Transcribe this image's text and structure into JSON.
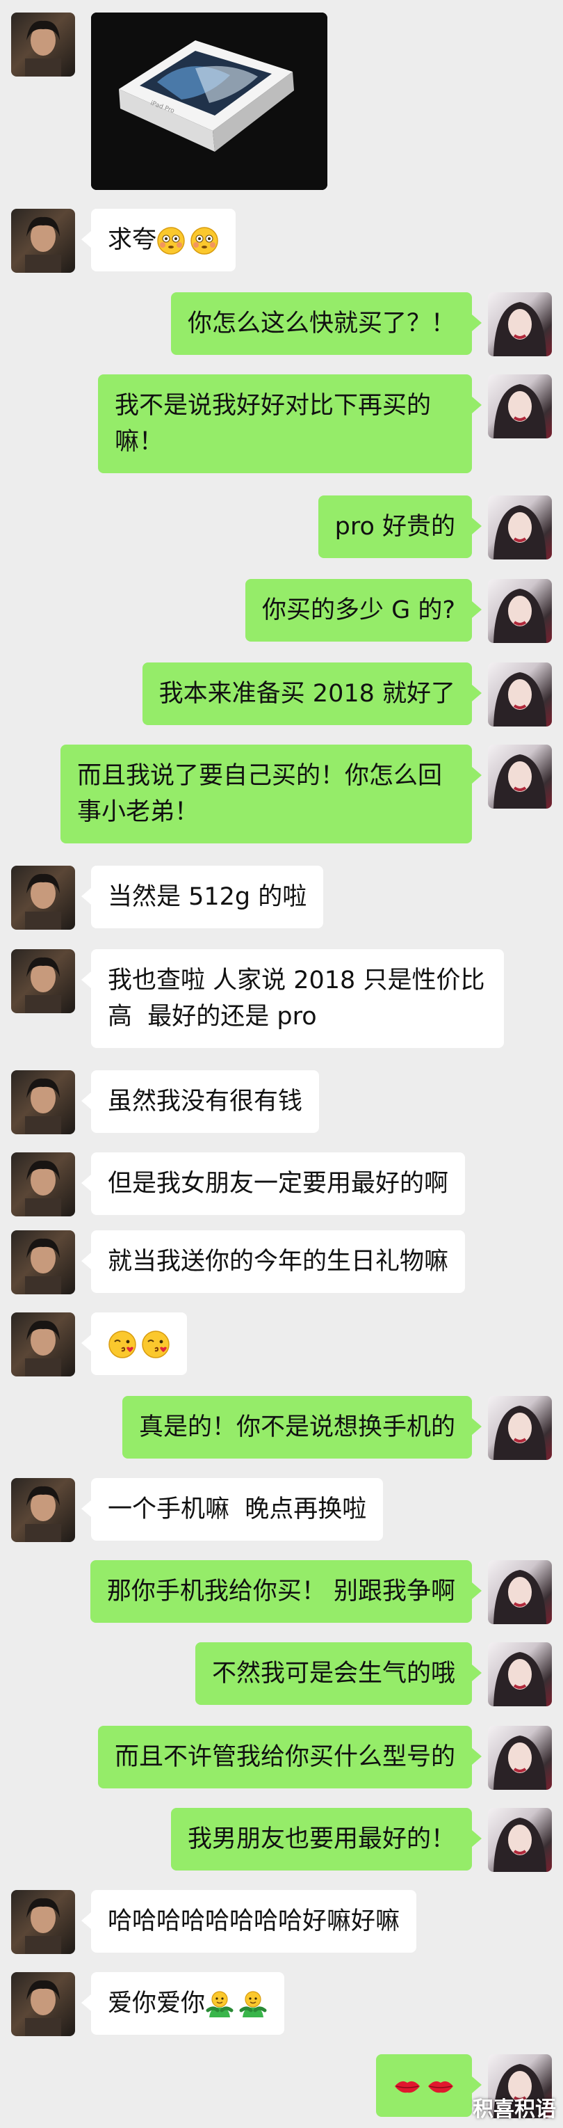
{
  "conversation": {
    "messages": [
      {
        "side": "left",
        "kind": "image",
        "image": "ipad-pro-box-photo"
      },
      {
        "side": "left",
        "kind": "text",
        "text": "求夸",
        "emojis": [
          "flushed-face-icon",
          "flushed-face-icon"
        ]
      },
      {
        "side": "right",
        "kind": "text",
        "text": "你怎么这么快就买了？！"
      },
      {
        "side": "right",
        "kind": "text",
        "text": "我不是说我好好对比下再买的嘛！"
      },
      {
        "side": "right",
        "kind": "text",
        "text": "pro 好贵的"
      },
      {
        "side": "right",
        "kind": "text",
        "text": "你买的多少 G 的?"
      },
      {
        "side": "right",
        "kind": "text",
        "text": "我本来准备买 2018 就好了"
      },
      {
        "side": "right",
        "kind": "text",
        "text": "而且我说了要自己买的！你怎么回事小老弟！"
      },
      {
        "side": "left",
        "kind": "text",
        "text": "当然是 512g 的啦"
      },
      {
        "side": "left",
        "kind": "text",
        "text": "我也查啦 人家说 2018 只是性价比高  最好的还是 pro"
      },
      {
        "side": "left",
        "kind": "text",
        "text": "虽然我没有很有钱"
      },
      {
        "side": "left",
        "kind": "text",
        "text": "但是我女朋友一定要用最好的啊"
      },
      {
        "side": "left",
        "kind": "text",
        "text": "就当我送你的今年的生日礼物嘛"
      },
      {
        "side": "left",
        "kind": "emoji",
        "text": "",
        "emojis": [
          "kissing-face-icon",
          "kissing-face-icon"
        ]
      },
      {
        "side": "right",
        "kind": "text",
        "text": "真是的！你不是说想换手机的"
      },
      {
        "side": "left",
        "kind": "text",
        "text": "一个手机嘛  晚点再换啦"
      },
      {
        "side": "right",
        "kind": "text",
        "text": "那你手机我给你买！ 别跟我争啊"
      },
      {
        "side": "right",
        "kind": "text",
        "text": "不然我可是会生气的哦"
      },
      {
        "side": "right",
        "kind": "text",
        "text": "而且不许管我给你买什么型号的"
      },
      {
        "side": "right",
        "kind": "text",
        "text": "我男朋友也要用最好的！"
      },
      {
        "side": "left",
        "kind": "text",
        "text": "哈哈哈哈哈哈哈哈好嘛好嘛"
      },
      {
        "side": "left",
        "kind": "text",
        "text": "爱你爱你",
        "emojis": [
          "hug-icon",
          "hug-icon"
        ]
      },
      {
        "side": "right",
        "kind": "emoji",
        "text": "",
        "emojis": [
          "lips-icon",
          "lips-icon"
        ]
      }
    ]
  },
  "watermark": "积喜积语",
  "colors": {
    "background": "#ededed",
    "bubble_mine": "#95ec69",
    "bubble_theirs": "#ffffff"
  }
}
